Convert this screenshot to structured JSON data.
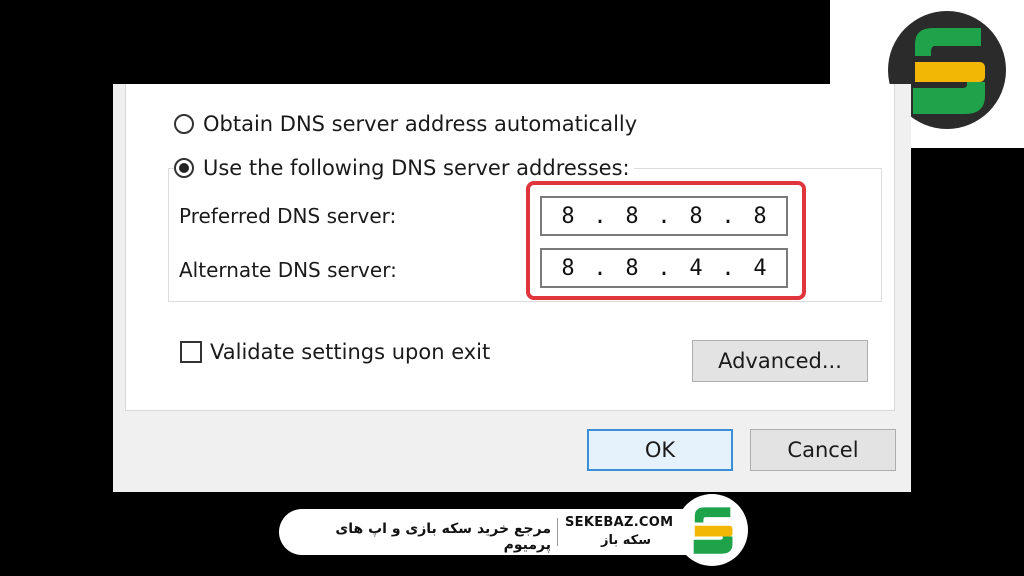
{
  "dns": {
    "auto_label": "Obtain DNS server address automatically",
    "manual_label": "Use the following DNS server addresses:",
    "preferred_label": "Preferred DNS server:",
    "alternate_label": "Alternate DNS server:",
    "preferred_octets": [
      "8",
      "8",
      "8",
      "8"
    ],
    "alternate_octets": [
      "8",
      "8",
      "4",
      "4"
    ],
    "selected": "manual"
  },
  "validate_label": "Validate settings upon exit",
  "buttons": {
    "advanced": "Advanced...",
    "ok": "OK",
    "cancel": "Cancel"
  },
  "banner": {
    "site": "SEKEBAZ.COM",
    "brand": "سکه باز",
    "tagline": "مرجع خرید سکه بازی و اپ های پرمیوم"
  },
  "colors": {
    "highlight": "#e0353c",
    "logo_green": "#1fa34a",
    "logo_yellow": "#f2b705"
  }
}
